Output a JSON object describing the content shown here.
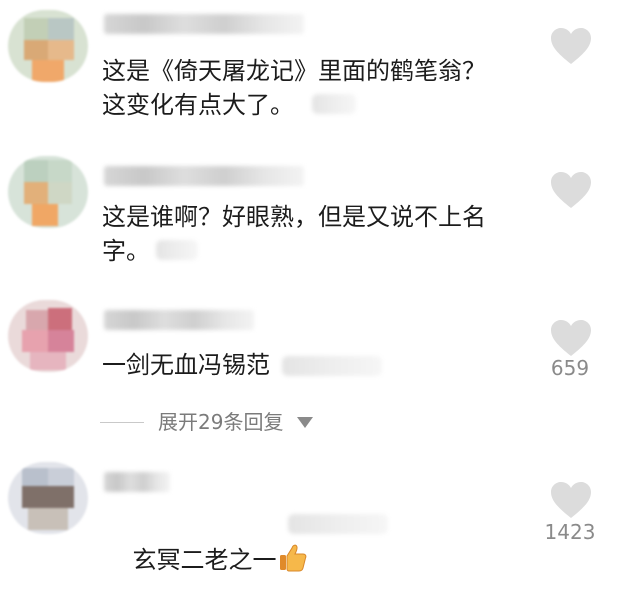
{
  "comments": [
    {
      "text": "这是《倚天屠龙记》里面的鹤笔翁？\n这变化有点大了。",
      "likes": ""
    },
    {
      "text": "这是谁啊？好眼熟，但是又说不上名\n字。",
      "likes": ""
    },
    {
      "text": "一剑无血冯锡范",
      "likes": "659"
    },
    {
      "text": "玄冥二老之一",
      "likes": "1423"
    }
  ],
  "expand_replies": {
    "label": "展开29条回复"
  },
  "icons": {
    "like": "heart-icon",
    "expand": "triangle-down-icon",
    "emoji": "thumbs-up-icon"
  },
  "colors": {
    "like_icon": "#dcdcdc",
    "count_text": "#8a8a8a",
    "secondary_text": "#7b7b7b"
  }
}
